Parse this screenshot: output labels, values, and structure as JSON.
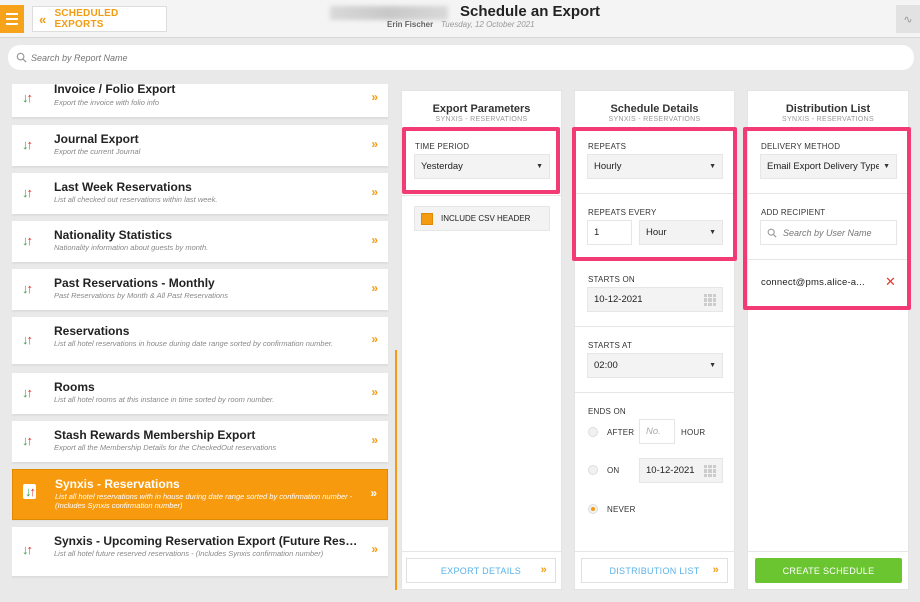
{
  "header": {
    "back_label": "SCHEDULED EXPORTS",
    "title": "Schedule an Export",
    "user": "Erin Fischer",
    "date": "Tuesday, 12 October 2021"
  },
  "search": {
    "placeholder": "Search by Report Name"
  },
  "reports": [
    {
      "name": "Invoice / Folio Export",
      "desc": "Export the invoice with folio info"
    },
    {
      "name": "Journal Export",
      "desc": "Export the current Journal"
    },
    {
      "name": "Last Week Reservations",
      "desc": "List all checked out reservations within last week."
    },
    {
      "name": "Nationality Statistics",
      "desc": "Nationality information about guests by month."
    },
    {
      "name": "Past Reservations - Monthly",
      "desc": "Past Reservations by Month & All Past Reservations"
    },
    {
      "name": "Reservations",
      "desc": "List all hotel reservations in house during date range sorted by confirmation number."
    },
    {
      "name": "Rooms",
      "desc": "List all hotel rooms at this instance in time sorted by room number."
    },
    {
      "name": "Stash Rewards Membership Export",
      "desc": "Export all the Membership Details for the CheckedOut reservations"
    },
    {
      "name": "Synxis - Reservations",
      "desc": "List all hotel reservations with in house during date range sorted by confirmation number - (Includes Synxis confirmation number)"
    },
    {
      "name": "Synxis - Upcoming Reservation Export (Future Reservations)",
      "desc": "List all hotel future reserved reservations - (Includes Synxis confirmation number)"
    }
  ],
  "export_params": {
    "title": "Export Parameters",
    "subtitle": "SYNXIS - RESERVATIONS",
    "time_period_label": "TIME PERIOD",
    "time_period_value": "Yesterday",
    "csv_header_label": "INCLUDE CSV HEADER",
    "footer": "EXPORT DETAILS"
  },
  "schedule": {
    "title": "Schedule Details",
    "subtitle": "SYNXIS - RESERVATIONS",
    "repeats_label": "REPEATS",
    "repeats_value": "Hourly",
    "repeats_every_label": "REPEATS EVERY",
    "repeats_every_number": "1",
    "repeats_every_unit": "Hour",
    "starts_on_label": "STARTS ON",
    "starts_on_value": "10-12-2021",
    "starts_at_label": "STARTS AT",
    "starts_at_value": "02:00",
    "ends_on_label": "ENDS ON",
    "after_label": "AFTER",
    "after_placeholder": "No.",
    "hour_label": "HOUR",
    "on_label": "ON",
    "on_value": "10-12-2021",
    "never_label": "NEVER",
    "footer": "DISTRIBUTION LIST"
  },
  "distribution": {
    "title": "Distribution List",
    "subtitle": "SYNXIS - RESERVATIONS",
    "delivery_label": "DELIVERY METHOD",
    "delivery_value": "Email Export Delivery Type",
    "add_recipient_label": "ADD RECIPIENT",
    "recipient_placeholder": "Search by User Name",
    "recipient": "connect@pms.alice-a...",
    "create_label": "CREATE SCHEDULE"
  },
  "colors": {
    "accent": "#f39c12",
    "highlight": "#f23b75",
    "create": "#6bc531",
    "link": "#5ab2e8"
  }
}
